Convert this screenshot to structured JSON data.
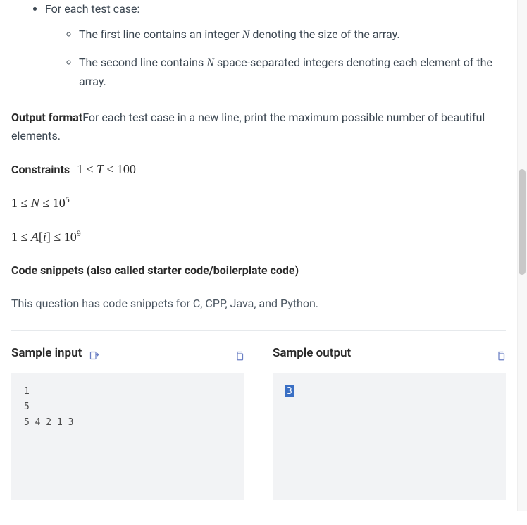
{
  "input_format": {
    "outer_item": "For each test case:",
    "inner_items": [
      {
        "pre": "The first line contains an integer ",
        "var": "N",
        "post": " denoting the size of the array."
      },
      {
        "pre": "The second line contains ",
        "var": "N",
        "post": " space-separated integers denoting each element of the array."
      }
    ]
  },
  "output_format": {
    "label": "Output format",
    "text": "For each test case in a new line, print the maximum possible number of beautiful elements."
  },
  "constraints": {
    "label": "Constraints",
    "lines": [
      "1 ≤ T ≤ 100",
      "1 ≤ N ≤ 10^5",
      "1 ≤ A[i] ≤ 10^9"
    ]
  },
  "code_snippets": {
    "heading": "Code snippets (also called starter code/boilerplate code)",
    "note": "This question has code snippets for C, CPP, Java, and Python."
  },
  "samples": {
    "input_label": "Sample input",
    "output_label": "Sample output",
    "input_text": "1\n5\n5 4 2 1 3",
    "output_text": "3"
  },
  "icons": {
    "export": "export-icon",
    "copy": "copy-icon"
  }
}
